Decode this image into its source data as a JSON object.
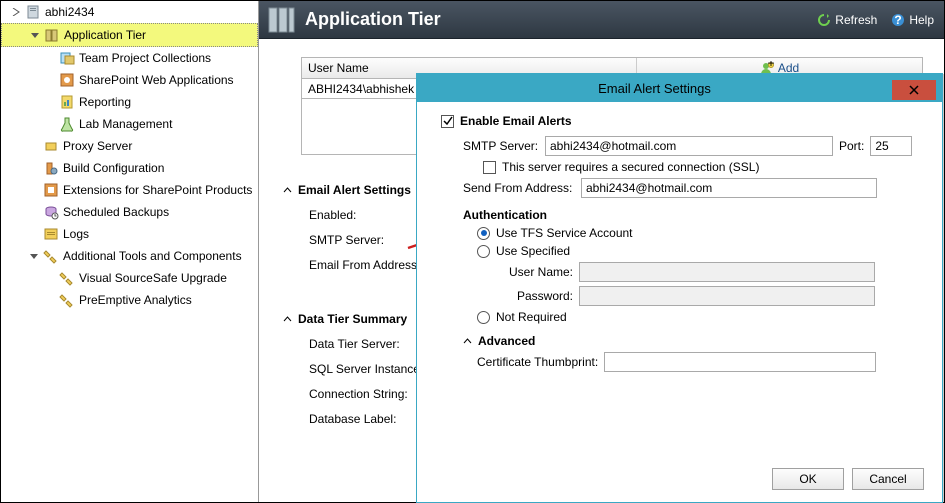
{
  "tree": {
    "root": "abhi2434",
    "appTier": "Application Tier",
    "items": [
      "Team Project Collections",
      "SharePoint Web Applications",
      "Reporting",
      "Lab Management"
    ],
    "proxy": "Proxy Server",
    "build": "Build Configuration",
    "ext": "Extensions for SharePoint Products",
    "sched": "Scheduled Backups",
    "logs": "Logs",
    "addl": "Additional Tools and Components",
    "addlItems": [
      "Visual SourceSafe Upgrade",
      "PreEmptive Analytics"
    ]
  },
  "banner": {
    "title": "Application Tier",
    "refresh": "Refresh",
    "help": "Help"
  },
  "grid": {
    "header": "User Name",
    "add": "Add",
    "row0": "ABHI2434\\abhishek"
  },
  "sections": {
    "email": {
      "title": "Email Alert Settings",
      "enabled": "Enabled:",
      "smtp": "SMTP Server:",
      "from": "Email From Address:"
    },
    "data": {
      "title": "Data Tier Summary",
      "server": "Data Tier Server:",
      "sql": "SQL Server Instance:",
      "conn": "Connection String:",
      "db": "Database Label:"
    }
  },
  "dialog": {
    "title": "Email Alert Settings",
    "enable": "Enable Email Alerts",
    "smtpLabel": "SMTP Server:",
    "smtpValue": "abhi2434@hotmail.com",
    "portLabel": "Port:",
    "portValue": "25",
    "ssl": "This server requires a secured connection (SSL)",
    "fromLabel": "Send From Address:",
    "fromValue": "abhi2434@hotmail.com",
    "auth": "Authentication",
    "useTfs": "Use TFS Service Account",
    "useSpec": "Use Specified",
    "userLabel": "User Name:",
    "passLabel": "Password:",
    "notReq": "Not Required",
    "adv": "Advanced",
    "cert": "Certificate Thumbprint:",
    "ok": "OK",
    "cancel": "Cancel"
  }
}
